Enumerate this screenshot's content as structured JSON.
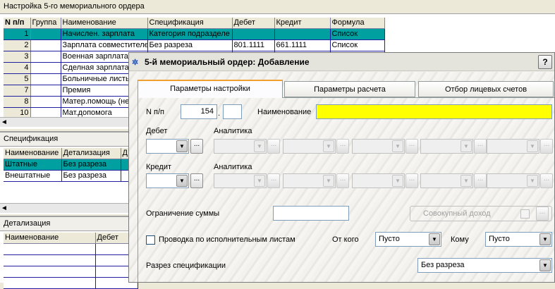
{
  "main": {
    "title": "Настройка 5-го мемориального ордера",
    "columns": [
      "N п/п",
      "Группа",
      "Наименование",
      "Спецификация",
      "Дебет",
      "Кредит",
      "Формула"
    ],
    "rows": [
      {
        "n": "1",
        "group": "",
        "name": "Начислен. зарплата",
        "spec": "Категория подразделе",
        "debit": "",
        "credit": "",
        "formula": "Список"
      },
      {
        "n": "2",
        "group": "",
        "name": "Зарплата совместителе",
        "spec": "Без разреза",
        "debit": "801.1111",
        "credit": "661.1111",
        "formula": "Список"
      },
      {
        "n": "3",
        "group": "",
        "name": "Военная зарплата 5НО",
        "spec": "",
        "debit": "",
        "credit": "",
        "formula": ""
      },
      {
        "n": "4",
        "group": "",
        "name": "Сделная зарплата",
        "spec": "",
        "debit": "",
        "credit": "",
        "formula": ""
      },
      {
        "n": "5",
        "group": "",
        "name": "Больничные листы",
        "spec": "",
        "debit": "",
        "credit": "",
        "formula": ""
      },
      {
        "n": "7",
        "group": "",
        "name": "Премия",
        "spec": "",
        "debit": "",
        "credit": "",
        "formula": ""
      },
      {
        "n": "8",
        "group": "",
        "name": "Матер.помощь (не",
        "spec": "",
        "debit": "",
        "credit": "",
        "formula": ""
      },
      {
        "n": "10",
        "group": "",
        "name": "Мат.допомога",
        "spec": "",
        "debit": "",
        "credit": "",
        "formula": ""
      }
    ]
  },
  "spec_panel": {
    "title": "Спецификация",
    "columns": [
      "Наименование",
      "Детализация",
      "Д"
    ],
    "rows": [
      {
        "name": "Штатные",
        "detail": "Без разреза",
        "d": ""
      },
      {
        "name": "Внештатные",
        "detail": "Без разреза",
        "d": ""
      }
    ]
  },
  "detail_panel": {
    "title": "Детализация",
    "columns": [
      "Наименование",
      "Дебет"
    ]
  },
  "dialog": {
    "title": "5-й мемориальный ордер: Добавление",
    "help": "?",
    "tabs": [
      "Параметры настройки",
      "Параметры расчета",
      "Отбор лицевых счетов"
    ],
    "np_label": "N п/п",
    "np_value": "154",
    "np_sep": ".",
    "name_label": "Наименование",
    "name_value": "",
    "debit_label": "Дебет",
    "credit_label": "Кредит",
    "analytics_label": "Аналитика",
    "limit_label": "Ограничение суммы",
    "combined_income_label": "Совокупный доход",
    "exec_list_label": "Проводка по исполнительным листам",
    "from_label": "От кого",
    "from_value": "Пусто",
    "to_label": "Кому",
    "to_value": "Пусто",
    "spec_cut_label": "Разрез спецификации",
    "spec_cut_value": "Без разреза",
    "ellipsis": "...",
    "scroll_left": "◄",
    "dropdown_arrow": "▼"
  },
  "colors": {
    "selected_row": "#00a0a0",
    "name_field": "#ffff00",
    "grid_line": "#1f1fa0"
  }
}
